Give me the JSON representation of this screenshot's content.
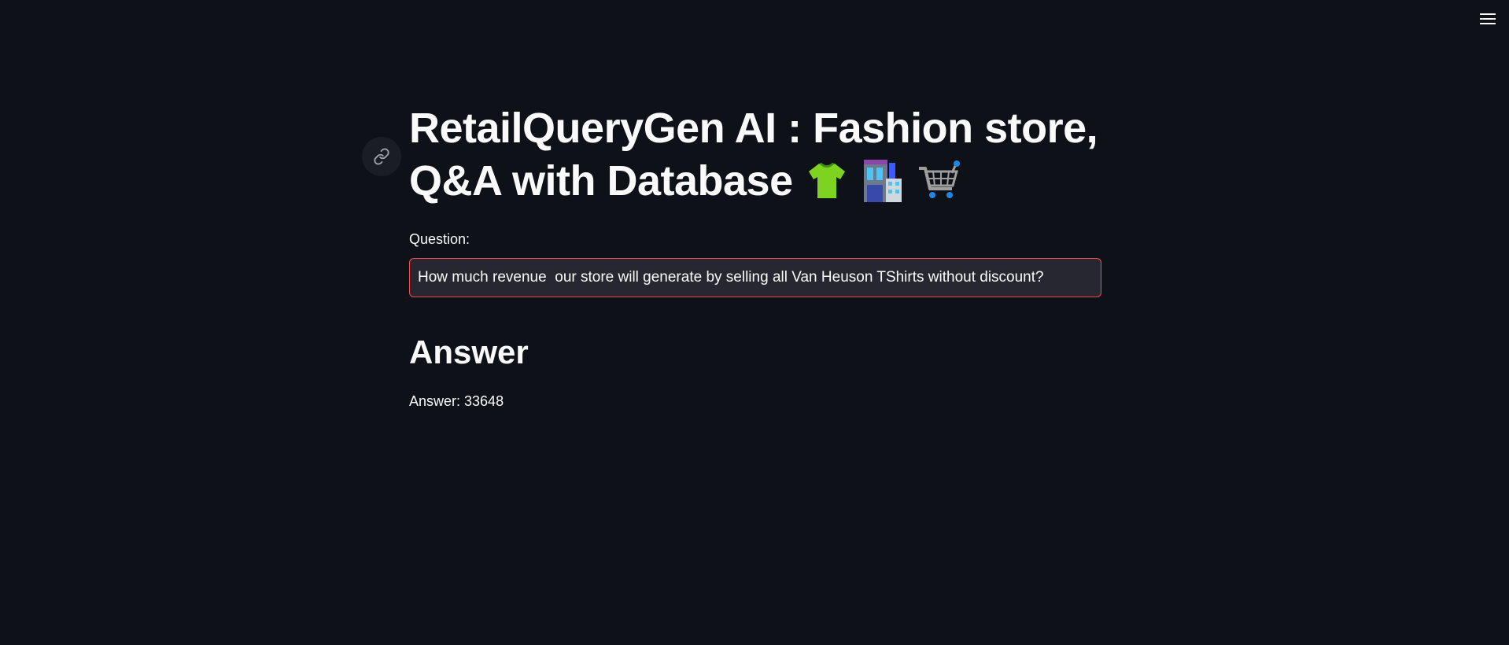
{
  "header": {
    "menu_icon": "hamburger-menu-icon"
  },
  "main": {
    "title": "RetailQueryGen AI : Fashion store, Q&A with Database",
    "title_emojis": {
      "tshirt": "tshirt-icon",
      "store": "store-building-icon",
      "cart": "shopping-cart-icon"
    },
    "anchor_icon": "link-icon",
    "question_label": "Question:",
    "question_value": "How much revenue  our store will generate by selling all Van Heuson TShirts without discount?",
    "answer_heading": "Answer",
    "answer_text": "Answer: 33648"
  },
  "colors": {
    "background": "#0e1117",
    "text": "#fafafa",
    "input_background": "#262730",
    "input_border_focus": "#ff4b4b"
  }
}
